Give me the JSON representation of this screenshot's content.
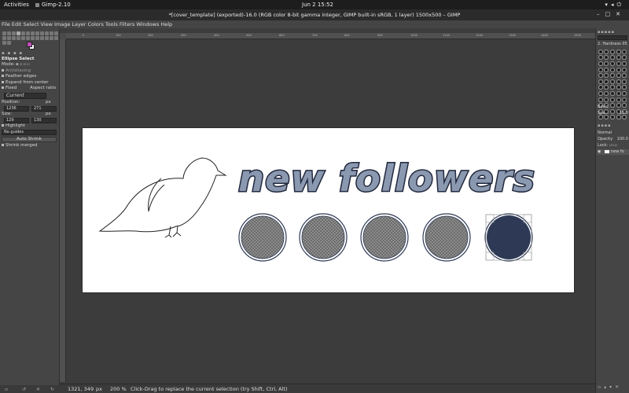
{
  "os_bar": {
    "activities": "Activities",
    "app_name": "Gimp-2.10",
    "datetime": "Jun 2  15:52"
  },
  "window": {
    "title": "*[cover_template] (exported)-16.0 (RGB color 8-bit gamma integer, GIMP built-in sRGB, 1 layer) 1500x500 – GIMP"
  },
  "menu": {
    "items": [
      "File",
      "Edit",
      "Select",
      "View",
      "Image",
      "Layer",
      "Colors",
      "Tools",
      "Filters",
      "Windows",
      "Help"
    ]
  },
  "tool_options": {
    "title": "Ellipse Select",
    "mode_label": "Mode:",
    "antialiasing": "Antialiasing",
    "feather_edges": "Feather edges",
    "expand_from_center": "Expand from center",
    "fixed_label": "Fixed",
    "fixed_value": "Aspect ratio",
    "current_value": "Current",
    "position_label": "Position:",
    "position_unit": "px",
    "position_x": "1236",
    "position_y": "271",
    "size_label": "Size:",
    "size_unit": "px",
    "size_w": "129",
    "size_h": "130",
    "highlight": "Highlight",
    "guides_value": "No guides",
    "auto_shrink": "Auto Shrink",
    "shrink_merged": "Shrink merged"
  },
  "rulers": {
    "top": [
      "0",
      "100",
      "200",
      "300",
      "400",
      "500",
      "600",
      "700",
      "800",
      "900",
      "1000",
      "1100",
      "1200",
      "1300",
      "1400",
      "1500"
    ]
  },
  "artwork": {
    "headline": "new followers",
    "circle_count": 5,
    "colors": {
      "circle_fill": "#7c7c7c",
      "circle_ring": "#2e3a55",
      "selected_circle_fill": "#2e3a55",
      "text_fill": "#8a98b0",
      "text_outline": "#232a3f"
    }
  },
  "statusbar": {
    "coords": "1321, 349",
    "unit": "px",
    "zoom": "200 %",
    "message": "Click-Drag to replace the current selection (try Shift, Ctrl, Alt)"
  },
  "right_dock": {
    "brush_name": "2. Hardness 05",
    "preset": "Basic,",
    "spacing_label": "Spa...",
    "spacing_value": "10.0",
    "mode": "Normal",
    "opacity_label": "Opacity",
    "opacity_value": "100.0",
    "lock_label": "Lock:",
    "layer_name": "new fo"
  }
}
